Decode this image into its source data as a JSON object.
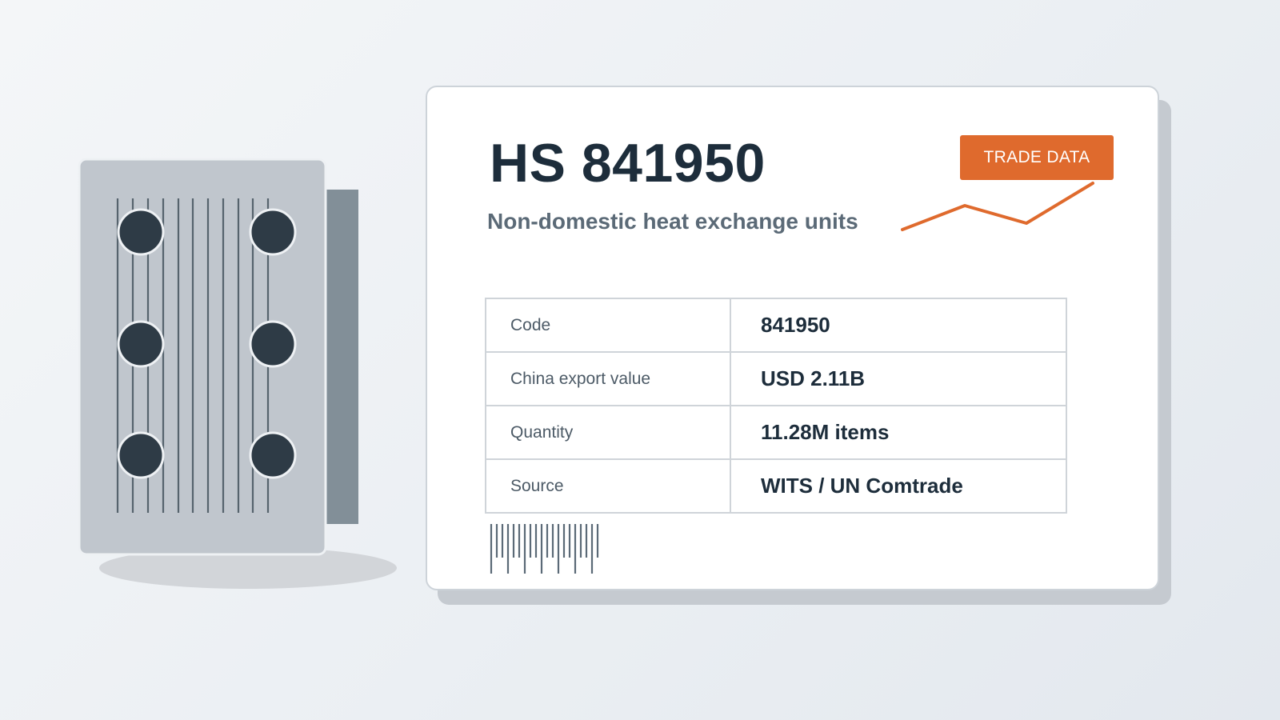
{
  "title": "HS 841950",
  "subtitle": "Non-domestic heat exchange units",
  "badge": "TRADE DATA",
  "colors": {
    "accent": "#df6a2d",
    "title": "#1d2d3b",
    "muted": "#5b6a77",
    "device_body": "#c0c6cd",
    "device_side": "#828f98",
    "port": "#2e3b46"
  },
  "table": {
    "rows": [
      {
        "label": "Code",
        "value": "841950"
      },
      {
        "label": "China export value",
        "value": "USD 2.11B"
      },
      {
        "label": "Quantity",
        "value": "11.28M items"
      },
      {
        "label": "Source",
        "value": "WITS / UN Comtrade"
      }
    ]
  },
  "icons": [
    "heat-exchanger-illustration",
    "sparkline-icon",
    "barcode-icon"
  ]
}
